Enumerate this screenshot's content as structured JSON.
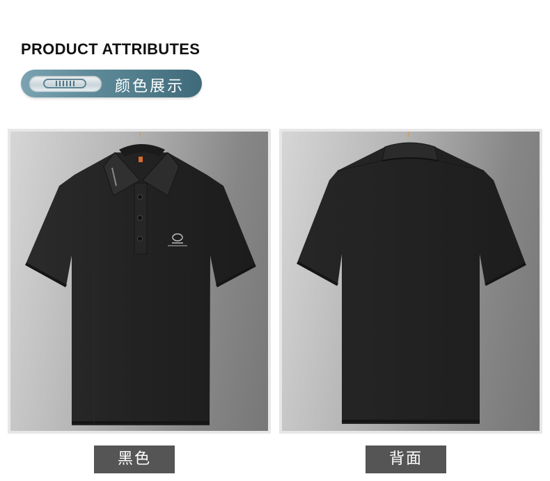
{
  "section_heading": "PRODUCT ATTRIBUTES",
  "color_display_label": "颜色展示",
  "views": [
    {
      "caption": "黑色",
      "image_icon": "polo-shirt-front-icon"
    },
    {
      "caption": "背面",
      "image_icon": "polo-shirt-back-icon"
    }
  ],
  "colors": {
    "accent": "#4f7d8c",
    "caption_bg": "#555555",
    "garment": "#262626"
  }
}
